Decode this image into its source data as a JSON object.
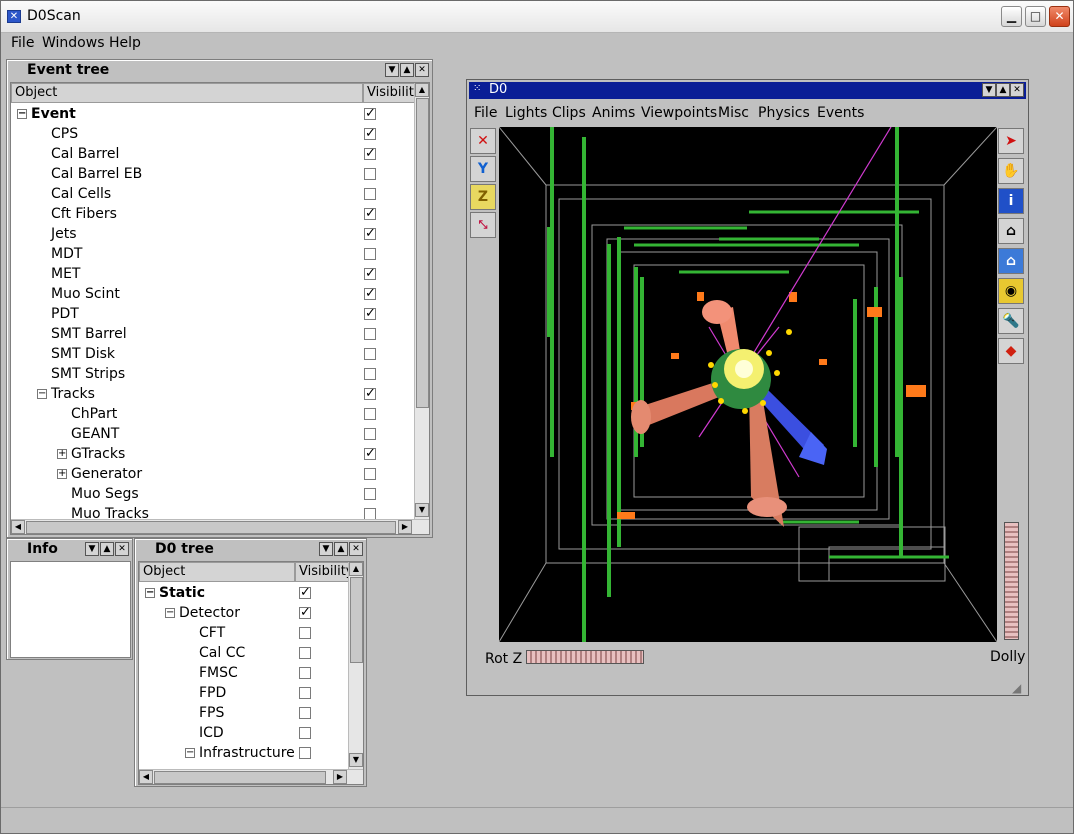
{
  "window": {
    "title": "D0Scan"
  },
  "menubar": [
    "File",
    "Windows",
    "Help"
  ],
  "event_tree": {
    "title": "Event  tree",
    "col_object": "Object",
    "col_visibility": "Visibility",
    "rows": [
      {
        "label": "Event",
        "checked": true
      },
      {
        "label": "CPS",
        "checked": true
      },
      {
        "label": "Cal Barrel",
        "checked": true
      },
      {
        "label": "Cal Barrel EB",
        "checked": false
      },
      {
        "label": "Cal Cells",
        "checked": false
      },
      {
        "label": "Cft Fibers",
        "checked": true
      },
      {
        "label": "Jets",
        "checked": true
      },
      {
        "label": "MDT",
        "checked": false
      },
      {
        "label": "MET",
        "checked": true
      },
      {
        "label": "Muo Scint",
        "checked": true
      },
      {
        "label": "PDT",
        "checked": true
      },
      {
        "label": "SMT Barrel",
        "checked": false
      },
      {
        "label": "SMT Disk",
        "checked": false
      },
      {
        "label": "SMT Strips",
        "checked": false
      },
      {
        "label": "Tracks",
        "checked": true
      },
      {
        "label": "ChPart",
        "checked": false
      },
      {
        "label": "GEANT",
        "checked": false
      },
      {
        "label": "GTracks",
        "checked": true
      },
      {
        "label": "Generator",
        "checked": false
      },
      {
        "label": "Muo Segs",
        "checked": false
      },
      {
        "label": "Muo Tracks",
        "checked": false
      }
    ]
  },
  "info_panel": {
    "title": "Info"
  },
  "d0_tree": {
    "title": "D0  tree",
    "col_object": "Object",
    "col_visibility": "Visibility",
    "rows": [
      {
        "label": "Static",
        "checked": true
      },
      {
        "label": "Detector",
        "checked": true
      },
      {
        "label": "CFT",
        "checked": false
      },
      {
        "label": "Cal CC",
        "checked": false
      },
      {
        "label": "FMSC",
        "checked": false
      },
      {
        "label": "FPD",
        "checked": false
      },
      {
        "label": "FPS",
        "checked": false
      },
      {
        "label": "ICD",
        "checked": false
      },
      {
        "label": "Infrastructure",
        "checked": false
      }
    ]
  },
  "viewer": {
    "title": "D0",
    "menu": [
      "File",
      "Lights",
      "Clips",
      "Anims",
      "Viewpoints",
      "Misc",
      "Physics",
      "Events"
    ],
    "left_tools": [
      "X",
      "Y",
      "Z",
      "arrow"
    ],
    "right_tools": [
      "pointer-icon",
      "hand-icon",
      "info-icon",
      "home-icon",
      "set-home-icon",
      "eye-icon",
      "flashlight-icon",
      "cube-icon"
    ],
    "rotz_label": "Rot Z",
    "dolly_label": "Dolly"
  },
  "colors": {
    "title_bar_blue": "#0a1e96",
    "bg_gray": "#c0c0c0"
  }
}
